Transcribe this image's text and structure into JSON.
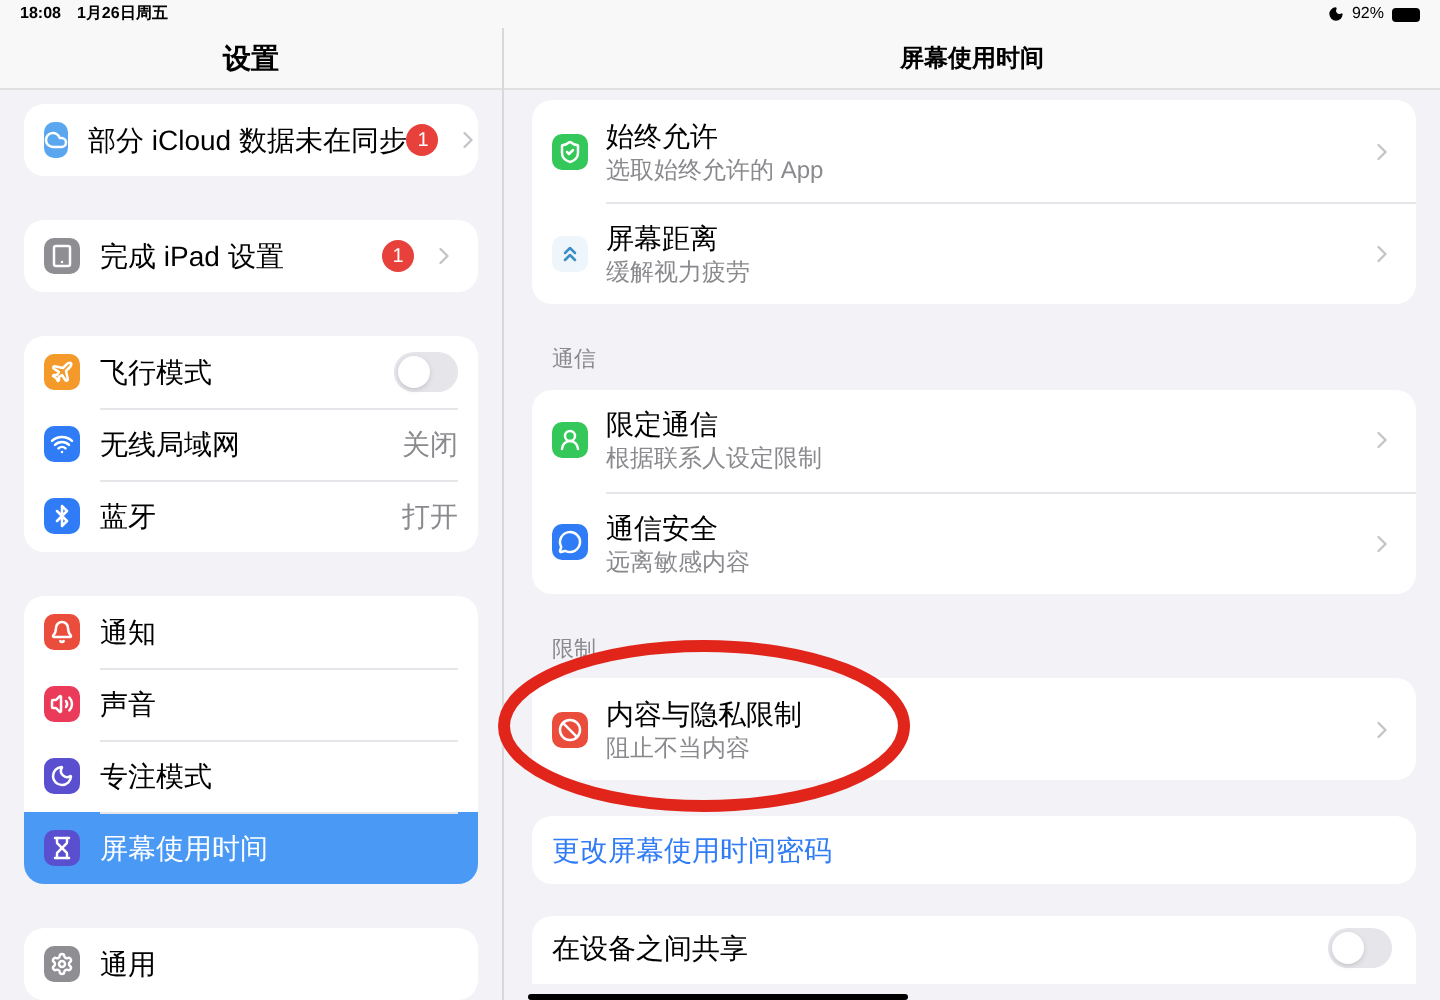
{
  "status_bar": {
    "time": "18:08",
    "date": "1月26日周五",
    "battery": "92%"
  },
  "sidebar": {
    "title": "设置",
    "groups": [
      {
        "items": [
          {
            "label": "部分 iCloud 数据未在同步",
            "kind": "badge",
            "badge": "1",
            "selected": false
          }
        ]
      },
      {
        "items": [
          {
            "label": "完成 iPad 设置",
            "kind": "badge",
            "badge": "1",
            "selected": false
          }
        ]
      },
      {
        "items": [
          {
            "label": "飞行模式",
            "kind": "toggle",
            "on": false,
            "selected": false
          },
          {
            "label": "无线局域网",
            "kind": "value",
            "value": "关闭",
            "selected": false
          },
          {
            "label": "蓝牙",
            "kind": "value",
            "value": "打开",
            "selected": false
          }
        ]
      },
      {
        "items": [
          {
            "label": "通知",
            "kind": "plain",
            "selected": false
          },
          {
            "label": "声音",
            "kind": "plain",
            "selected": false
          },
          {
            "label": "专注模式",
            "kind": "plain",
            "selected": false
          },
          {
            "label": "屏幕使用时间",
            "kind": "plain",
            "selected": true
          }
        ]
      },
      {
        "items": [
          {
            "label": "通用",
            "kind": "plain",
            "selected": false
          }
        ]
      }
    ]
  },
  "detail": {
    "title": "屏幕使用时间",
    "sections": [
      {
        "items": [
          {
            "title": "始终允许",
            "subtitle": "选取始终允许的 App"
          },
          {
            "title": "屏幕距离",
            "subtitle": "缓解视力疲劳"
          }
        ]
      },
      {
        "header": "通信",
        "items": [
          {
            "title": "限定通信",
            "subtitle": "根据联系人设定限制"
          },
          {
            "title": "通信安全",
            "subtitle": "远离敏感内容"
          }
        ]
      },
      {
        "header": "限制",
        "items": [
          {
            "title": "内容与隐私限制",
            "subtitle": "阻止不当内容"
          }
        ]
      }
    ],
    "link": "更改屏幕使用时间密码",
    "share_row": {
      "label": "在设备之间共享",
      "on": false
    }
  }
}
